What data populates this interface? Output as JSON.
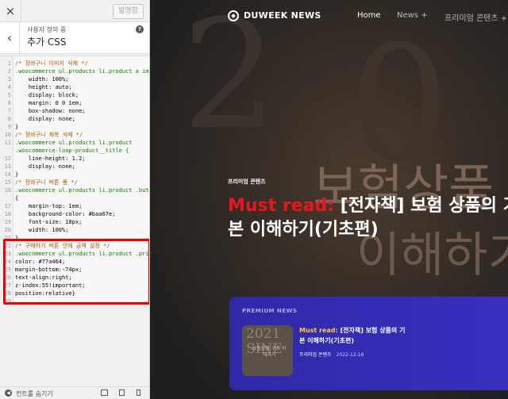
{
  "panel": {
    "close_icon": "×",
    "publish_label": "발행함",
    "back_icon": "‹",
    "breadcrumb": "사용자 정의 중",
    "title": "추가 CSS",
    "help_icon": "?",
    "hide_controls_label": "컨트롤 숨기기"
  },
  "code_lines": [
    {
      "n": "1",
      "t": "/* 장바구니 이미지 삭제 */",
      "c": "comment"
    },
    {
      "n": "2",
      "t": ".woocommerce ul.products li.product a img {",
      "c": "sel"
    },
    {
      "n": "3",
      "t": "    width: 100%;",
      "c": "prop"
    },
    {
      "n": "4",
      "t": "    height: auto;",
      "c": "prop"
    },
    {
      "n": "5",
      "t": "    display: block;",
      "c": "prop"
    },
    {
      "n": "6",
      "t": "    margin: 0 0 1em;",
      "c": "prop"
    },
    {
      "n": "7",
      "t": "    box-shadow: none;",
      "c": "prop"
    },
    {
      "n": "8",
      "t": "    display: none;",
      "c": "prop"
    },
    {
      "n": "9",
      "t": "}",
      "c": "prop"
    },
    {
      "n": "10",
      "t": "/* 장바구니 제목 삭제 */",
      "c": "comment"
    },
    {
      "n": "11",
      "t": ".woocommerce ul.products li.product",
      "c": "sel"
    },
    {
      "n": "",
      "t": ".woocommerce-loop-product__title {",
      "c": "sel"
    },
    {
      "n": "12",
      "t": "    line-height: 1.2;",
      "c": "prop"
    },
    {
      "n": "13",
      "t": "    display: none;",
      "c": "prop"
    },
    {
      "n": "14",
      "t": "}",
      "c": "prop"
    },
    {
      "n": "15",
      "t": "/* 장바구니 버튼 폼 */",
      "c": "comment"
    },
    {
      "n": "16",
      "t": ".woocommerce ul.products li.product .button",
      "c": "sel"
    },
    {
      "n": "",
      "t": "{",
      "c": "prop"
    },
    {
      "n": "17",
      "t": "    margin-top: 1em;",
      "c": "prop"
    },
    {
      "n": "18",
      "t": "    background-color: #baa67e;",
      "c": "prop"
    },
    {
      "n": "19",
      "t": "    font-size: 18px;",
      "c": "prop"
    },
    {
      "n": "20",
      "t": "    width: 100%;",
      "c": "prop"
    },
    {
      "n": "21",
      "t": "}",
      "c": "prop"
    },
    {
      "n": "22",
      "t": "/* 구매하기 버튼 안에 금액 설정 */",
      "c": "comment"
    },
    {
      "n": "23",
      "t": ".woocommerce ul.products li.product .price{",
      "c": "sel"
    },
    {
      "n": "24",
      "t": "color: #77a464;",
      "c": "prop"
    },
    {
      "n": "25",
      "t": "margin-bottom:-74px;",
      "c": "prop"
    },
    {
      "n": "26",
      "t": "text-align:right;",
      "c": "prop"
    },
    {
      "n": "27",
      "t": "z-index:55!important;",
      "c": "prop"
    },
    {
      "n": "28",
      "t": "position:relative}",
      "c": "prop"
    },
    {
      "n": "29",
      "t": "",
      "c": "prop"
    }
  ],
  "site": {
    "logo": "DUWEEK NEWS",
    "nav": [
      "Home",
      "News  +",
      "프리미엄 콘텐츠  +"
    ],
    "hero_category": "프리미엄 콘텐츠",
    "hero_must": "Must read:",
    "hero_title": " [전자책] 보험 상품의 기본 이해하기(기초편)",
    "bg_text_top": "보험상품",
    "bg_text_bottom": "이해하기",
    "card": {
      "label": "PREMIUM NEWS",
      "thumb_year": "2021",
      "thumb_word": "SINE",
      "thumb_caption": "보험상품 구조 이해하기",
      "must": "Must read:",
      "title": " [전자책] 보험 상품의 기본 이해하기(기초편)",
      "category": "프리미엄 콘텐츠",
      "date": "2022-12-16"
    }
  },
  "colors": {
    "red_highlight": "#e00000",
    "must_red": "#e8161e",
    "card_blue": "#3a2fc0"
  }
}
